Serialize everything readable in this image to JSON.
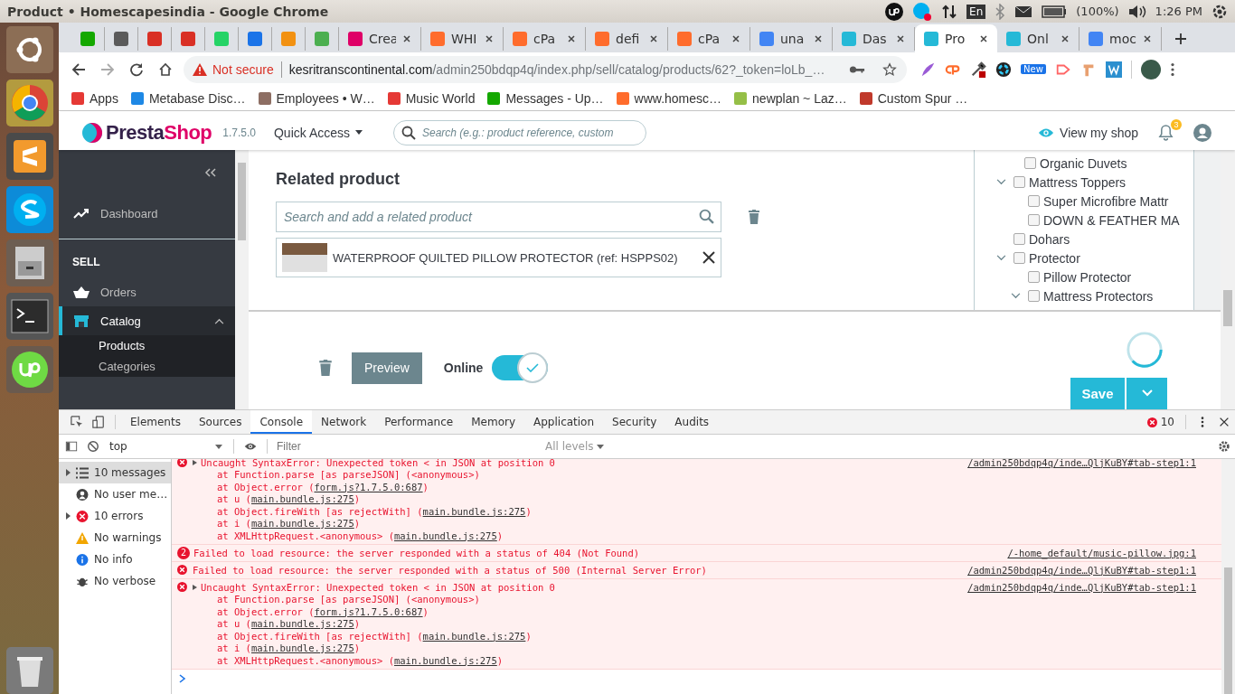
{
  "os_bar": {
    "title": "Product • Homescapesindia - Google Chrome",
    "keyboard": "En",
    "battery": "(100%)",
    "clock": "1:26 PM"
  },
  "tabs": [
    {
      "selected": false
    },
    {
      "selected": false
    },
    {
      "selected": false
    },
    {
      "selected": false
    },
    {
      "selected": false
    },
    {
      "selected": false
    },
    {
      "selected": false
    },
    {
      "selected": false
    },
    {
      "title": "Crea",
      "selected": false
    },
    {
      "title": "WHI",
      "selected": false
    },
    {
      "title": "cPa",
      "selected": false
    },
    {
      "title": "defi",
      "selected": false
    },
    {
      "title": "cPa",
      "selected": false
    },
    {
      "title": "una",
      "selected": false
    },
    {
      "title": "Das",
      "selected": false
    },
    {
      "title": "Pro",
      "selected": true
    },
    {
      "title": "Onl",
      "selected": false
    },
    {
      "title": "moc",
      "selected": false
    }
  ],
  "address_bar": {
    "security": "Not secure",
    "host": "kesritranscontinental.com",
    "path": "/admin250bdqp4q/index.php/sell/catalog/products/62?_token=loLb_…",
    "extension_badge": "New"
  },
  "bookmarks": [
    {
      "label": "Apps"
    },
    {
      "label": "Metabase Disc…"
    },
    {
      "label": "Employees • W…"
    },
    {
      "label": "Music World"
    },
    {
      "label": "Messages - Up…"
    },
    {
      "label": "www.homesc…"
    },
    {
      "label": "newplan ~ Laz…"
    },
    {
      "label": "Custom Spur …"
    }
  ],
  "header": {
    "logo_dark": "Presta",
    "logo_accent": "Shop",
    "version": "1.7.5.0",
    "quick_access": "Quick Access",
    "search_placeholder": "Search (e.g.: product reference, custom",
    "view_shop": "View my shop",
    "notifications": "3"
  },
  "sidebar": {
    "items": [
      {
        "kind": "link",
        "label": "Dashboard",
        "selected": false
      },
      {
        "kind": "section",
        "label": "SELL"
      },
      {
        "kind": "link",
        "label": "Orders",
        "selected": false
      },
      {
        "kind": "link",
        "label": "Catalog",
        "selected": true,
        "expanded": true
      },
      {
        "kind": "sub",
        "label": "Products",
        "selected": true
      },
      {
        "kind": "sub",
        "label": "Categories",
        "selected": false
      }
    ]
  },
  "related": {
    "title": "Related product",
    "placeholder": "Search and add a related product",
    "items": [
      {
        "name": "WATERPROOF QUILTED PILLOW PROTECTOR (ref: HSPPS02)"
      }
    ]
  },
  "category_tree": {
    "leading_children": [
      {
        "label": "Organic Duvets",
        "checked": false
      }
    ],
    "items": [
      {
        "label": "Mattress Toppers",
        "checked": false,
        "expanded": true,
        "children": [
          {
            "label": "Super Microfibre Mattr",
            "checked": false
          },
          {
            "label": "DOWN & FEATHER MA",
            "checked": false
          }
        ]
      },
      {
        "label": "Dohars",
        "checked": false
      },
      {
        "label": "Protector",
        "checked": false,
        "expanded": true,
        "children": [
          {
            "label": "Pillow Protector",
            "checked": false
          },
          {
            "label": "Mattress Protectors",
            "checked": false,
            "expanded": true
          }
        ]
      }
    ]
  },
  "footer": {
    "preview": "Preview",
    "online_label": "Online",
    "online": true,
    "save": "Save"
  },
  "devtools": {
    "tabs": [
      {
        "label": "Elements",
        "selected": false
      },
      {
        "label": "Sources",
        "selected": false
      },
      {
        "label": "Console",
        "selected": true
      },
      {
        "label": "Network",
        "selected": false
      },
      {
        "label": "Performance",
        "selected": false
      },
      {
        "label": "Memory",
        "selected": false
      },
      {
        "label": "Application",
        "selected": false
      },
      {
        "label": "Security",
        "selected": false
      },
      {
        "label": "Audits",
        "selected": false
      }
    ],
    "error_count": "10",
    "context": "top",
    "filter_placeholder": "Filter",
    "levels": "All levels",
    "sidebar": [
      {
        "label": "10 messages",
        "selected": true,
        "expandable": true
      },
      {
        "label": "No user me…",
        "selected": false,
        "expandable": false
      },
      {
        "label": "10 errors",
        "selected": false,
        "expandable": true
      },
      {
        "label": "No warnings",
        "selected": false,
        "expandable": false
      },
      {
        "label": "No info",
        "selected": false,
        "expandable": false
      },
      {
        "label": "No verbose",
        "selected": false,
        "expandable": false
      }
    ],
    "messages": [
      {
        "expandable": true,
        "text": "Uncaught SyntaxError: Unexpected token < in JSON at position 0",
        "source": "/admin250bdqp4q/inde…QljKuBY#tab-step1:1",
        "stack": [
          {
            "text": "at Function.parse [as parseJSON] (<anonymous>)"
          },
          {
            "text": "at Object.error (",
            "link": "form.js?1.7.5.0:687",
            "after": ")"
          },
          {
            "text": "at u (",
            "link": "main.bundle.js:275",
            "after": ")"
          },
          {
            "text": "at Object.fireWith [as rejectWith] (",
            "link": "main.bundle.js:275",
            "after": ")"
          },
          {
            "text": "at i (",
            "link": "main.bundle.js:275",
            "after": ")"
          },
          {
            "text": "at XMLHttpRequest.<anonymous> (",
            "link": "main.bundle.js:275",
            "after": ")"
          }
        ]
      },
      {
        "count": "2",
        "text": "Failed to load resource: the server responded with a status of 404 (Not Found)",
        "source": "/-home_default/music-pillow.jpg:1"
      },
      {
        "text": "Failed to load resource: the server responded with a status of 500 (Internal Server Error)",
        "source": "/admin250bdqp4q/inde…QljKuBY#tab-step1:1"
      },
      {
        "expandable": true,
        "text": "Uncaught SyntaxError: Unexpected token < in JSON at position 0",
        "source": "/admin250bdqp4q/inde…QljKuBY#tab-step1:1",
        "stack": [
          {
            "text": "at Function.parse [as parseJSON] (<anonymous>)"
          },
          {
            "text": "at Object.error (",
            "link": "form.js?1.7.5.0:687",
            "after": ")"
          },
          {
            "text": "at u (",
            "link": "main.bundle.js:275",
            "after": ")"
          },
          {
            "text": "at Object.fireWith [as rejectWith] (",
            "link": "main.bundle.js:275",
            "after": ")"
          },
          {
            "text": "at i (",
            "link": "main.bundle.js:275",
            "after": ")"
          },
          {
            "text": "at XMLHttpRequest.<anonymous> (",
            "link": "main.bundle.js:275",
            "after": ")"
          }
        ]
      }
    ]
  }
}
